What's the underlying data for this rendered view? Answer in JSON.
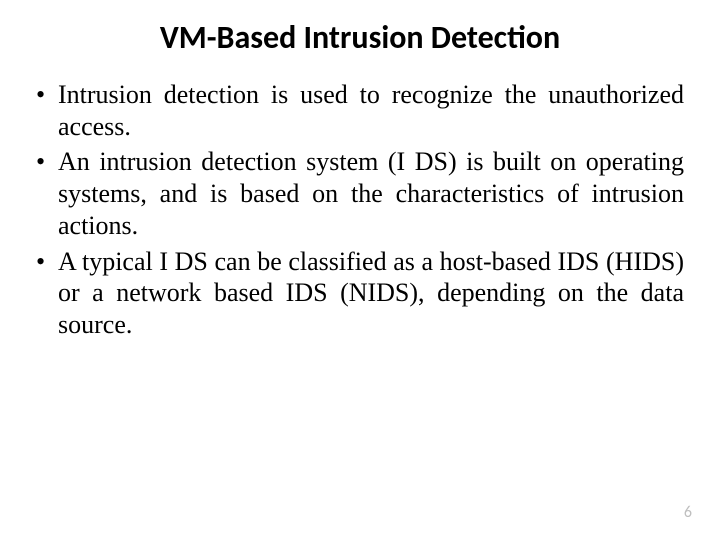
{
  "title": "VM-Based Intrusion Detection",
  "bullets": [
    "Intrusion detection is used to recognize the unauthorized access.",
    "An intrusion detection system (I DS) is built on operating systems, and is based on the characteristics of intrusion actions.",
    "A typical I DS can be classified as a host-based IDS (HIDS) or a network based IDS (NIDS), depending on the data source."
  ],
  "page_number": "6"
}
